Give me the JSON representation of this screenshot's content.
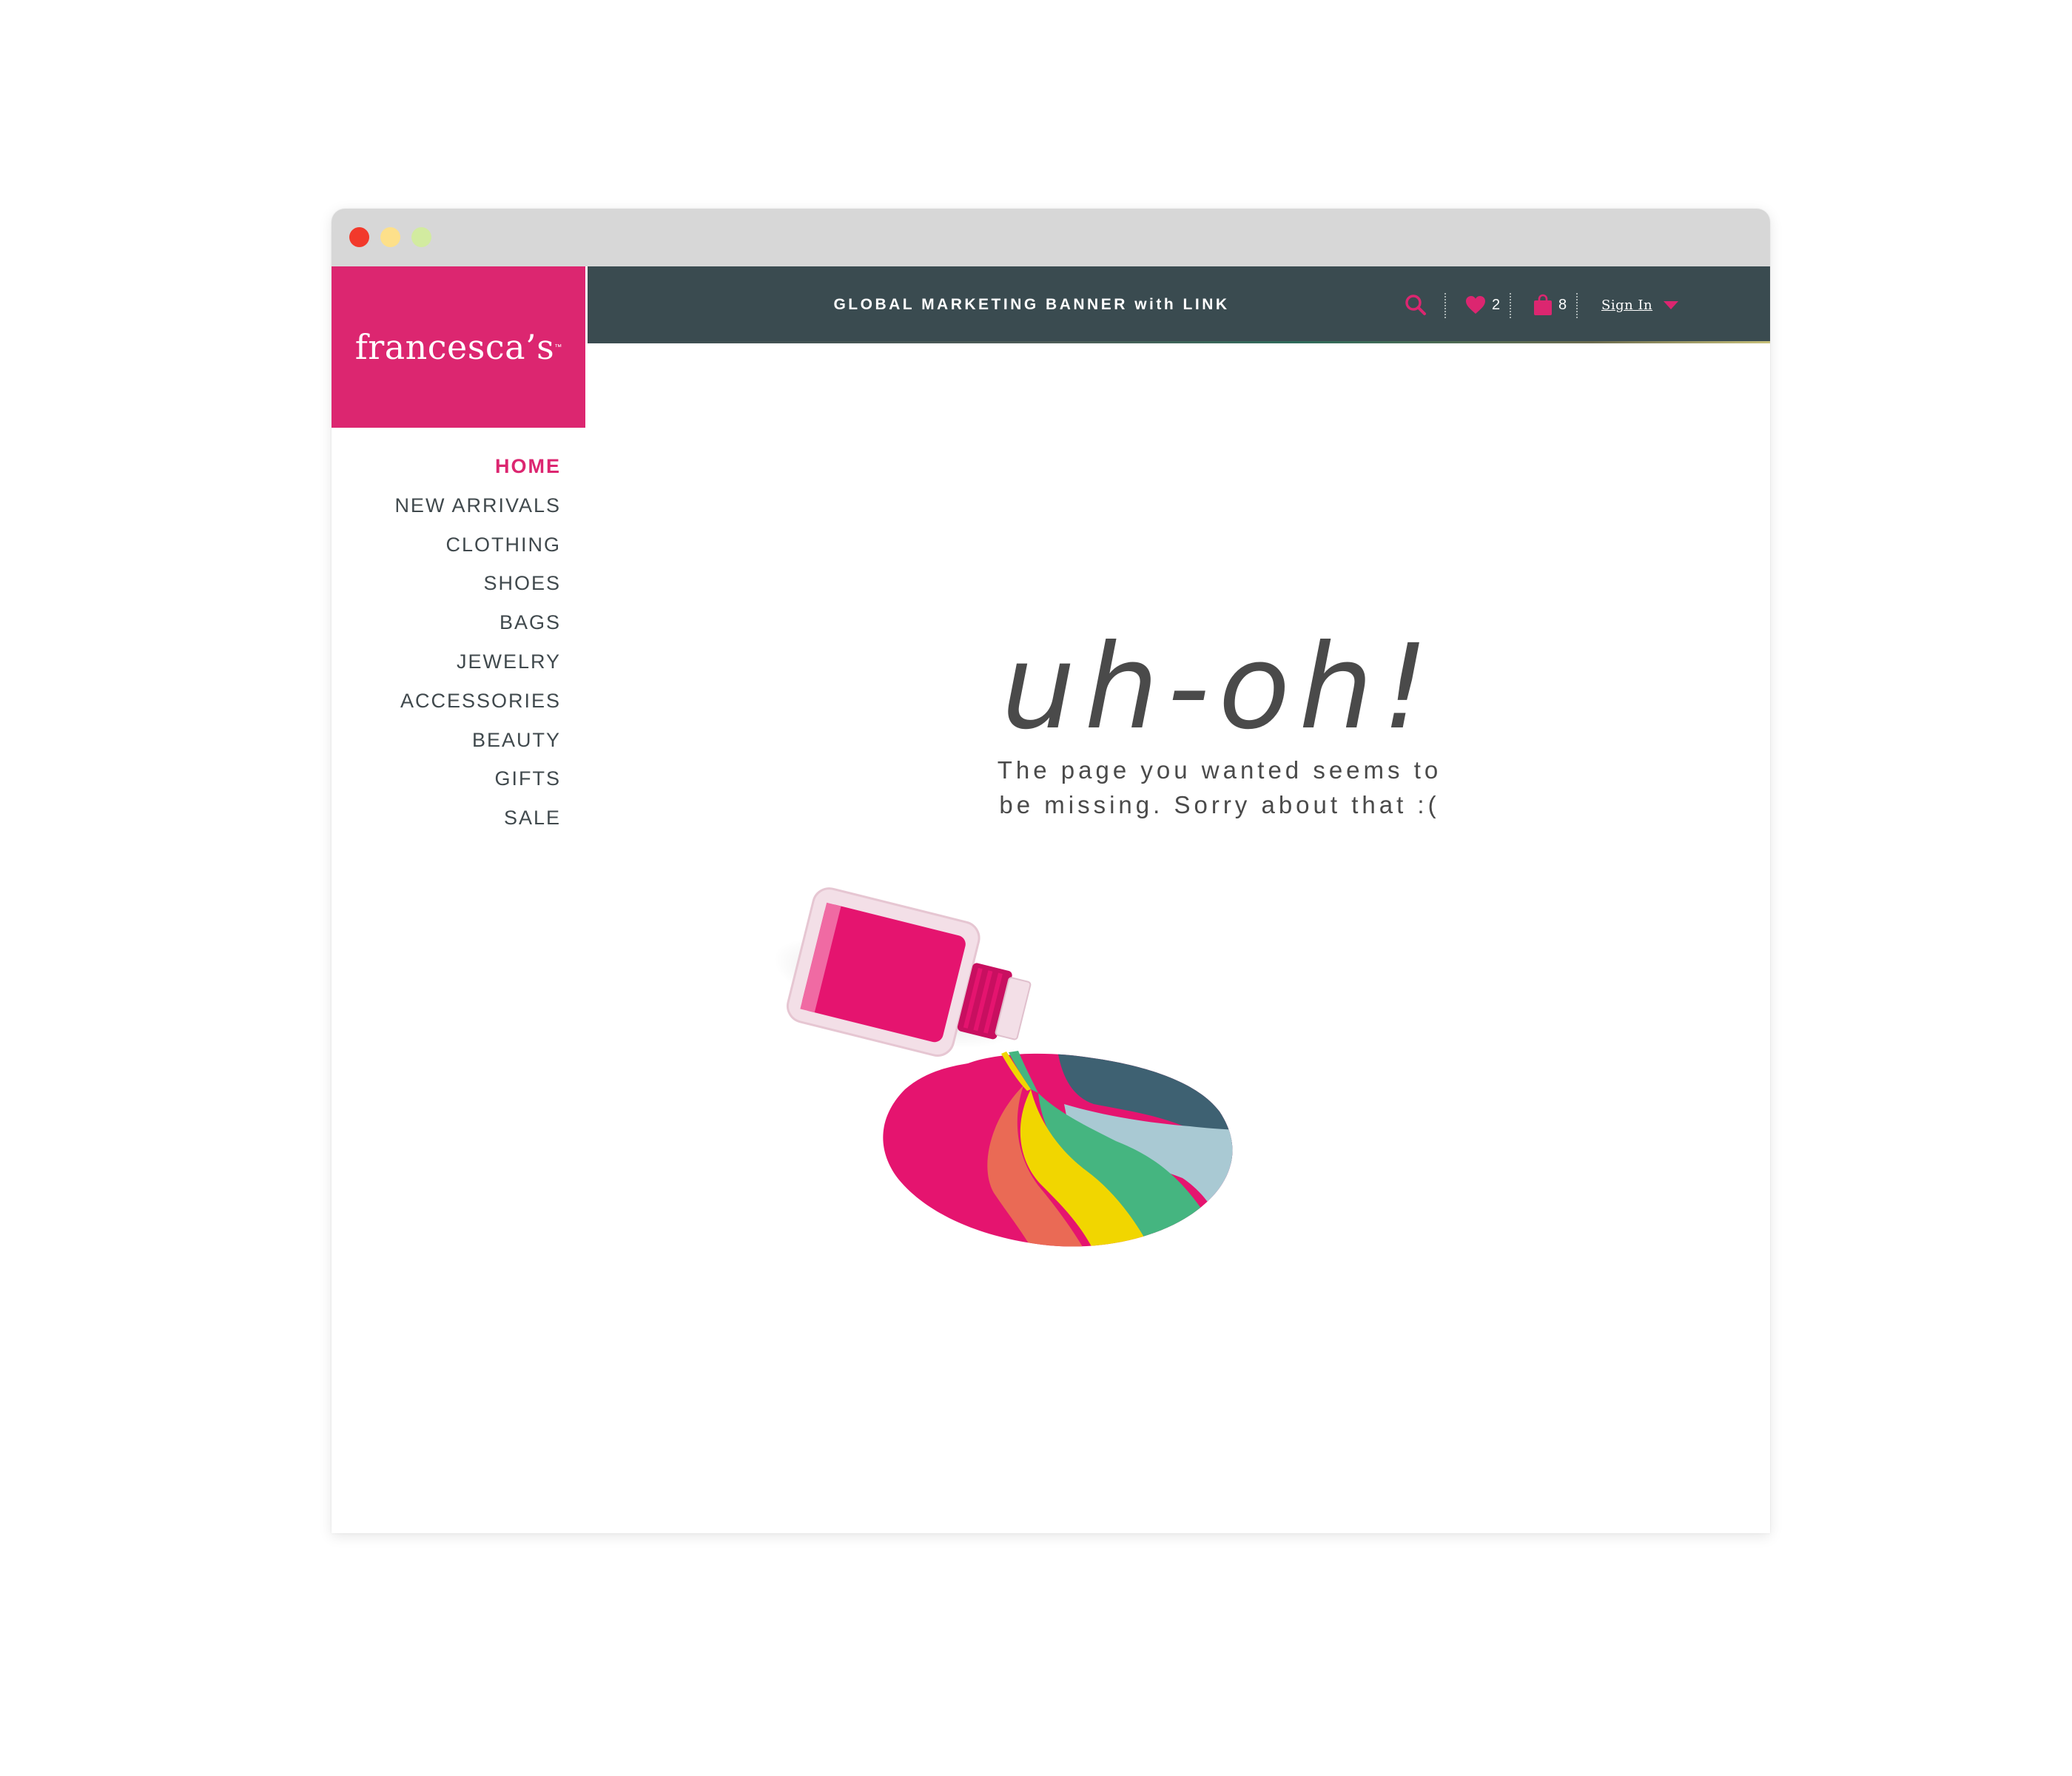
{
  "brand": {
    "name": "francesca’s",
    "colors": {
      "pink": "#dc2670",
      "dark": "#3a4b50",
      "text": "#40494d"
    }
  },
  "window": {
    "controls": [
      "close",
      "minimize",
      "zoom"
    ],
    "control_colors": {
      "close": "#f2392b",
      "minimize": "#fde08a",
      "zoom": "#d2eba0"
    }
  },
  "topbar": {
    "banner_text": "GLOBAL MARKETING BANNER with LINK",
    "search_icon": "search-icon",
    "wishlist": {
      "icon": "heart-icon",
      "count": "2"
    },
    "cart": {
      "icon": "shopping-bag-icon",
      "count": "8"
    },
    "signin_label": "Sign In",
    "signin_icon": "caret-down-icon"
  },
  "nav": {
    "items": [
      {
        "label": "HOME",
        "active": true
      },
      {
        "label": "NEW ARRIVALS"
      },
      {
        "label": "CLOTHING"
      },
      {
        "label": "SHOES"
      },
      {
        "label": "BAGS"
      },
      {
        "label": "JEWELRY"
      },
      {
        "label": "ACCESSORIES"
      },
      {
        "label": "BEAUTY"
      },
      {
        "label": "GIFTS"
      },
      {
        "label": "SALE"
      }
    ]
  },
  "error": {
    "headline": "uh-oh!",
    "message_line1": "The page you wanted seems to",
    "message_line2": "be missing. Sorry about that :(",
    "illustration": "spilled-nail-polish-rainbow"
  }
}
